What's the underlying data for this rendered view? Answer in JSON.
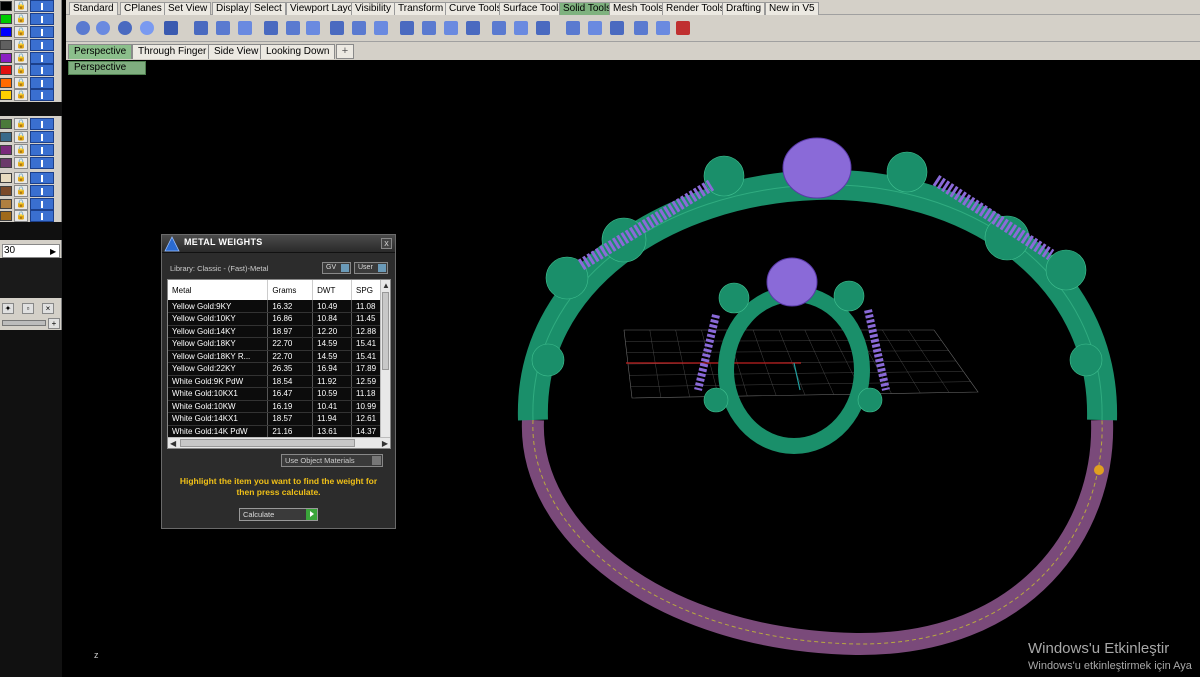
{
  "toolbar": {
    "tabs": [
      "Standard",
      "CPlanes",
      "Set View",
      "Display",
      "Select",
      "Viewport Layout",
      "Visibility",
      "Transform",
      "Curve Tools",
      "Surface Tools",
      "Solid Tools",
      "Mesh Tools",
      "Render Tools",
      "Drafting",
      "New in V5"
    ],
    "active_tab": "Solid Tools"
  },
  "viewport_tabs": {
    "tabs": [
      "Perspective",
      "Through Finger",
      "Side View",
      "Looking Down"
    ],
    "active_tab": "Perspective",
    "add_tab_symbol": "+"
  },
  "viewport": {
    "label": "Perspective",
    "axis_label": "z"
  },
  "left_panel": {
    "value": "30",
    "lock_symbol": "🔒",
    "layer_colors": [
      "#000000",
      "#00cc00",
      "#0000ff",
      "#606060",
      "#8a1fc2",
      "#e01010",
      "#ff6a00",
      "#ffd000",
      "#4a7a3a",
      "#3a6a8a",
      "#7a2a7a",
      "#6a3a6a",
      "#e8dcc0",
      "#7a4a2a",
      "#b08040",
      "#a06a1a"
    ]
  },
  "dialog": {
    "title": "METAL WEIGHTS",
    "close_symbol": "x",
    "library_label": "Library: Classic - (Fast)-Metal",
    "gv_select": "GV",
    "user_select": "User",
    "columns": [
      "Metal",
      "Grams",
      "DWT",
      "SPG"
    ],
    "rows": [
      [
        "Yellow Gold:9KY",
        "16.32",
        "10.49",
        "11.08"
      ],
      [
        "Yellow Gold:10KY",
        "16.86",
        "10.84",
        "11.45"
      ],
      [
        "Yellow Gold:14KY",
        "18.97",
        "12.20",
        "12.88"
      ],
      [
        "Yellow Gold:18KY",
        "22.70",
        "14.59",
        "15.41"
      ],
      [
        "Yellow Gold:18KY R...",
        "22.70",
        "14.59",
        "15.41"
      ],
      [
        "Yellow Gold:22KY",
        "26.35",
        "16.94",
        "17.89"
      ],
      [
        "White Gold:9K PdW",
        "18.54",
        "11.92",
        "12.59"
      ],
      [
        "White Gold:10KX1",
        "16.47",
        "10.59",
        "11.18"
      ],
      [
        "White Gold:10KW",
        "16.19",
        "10.41",
        "10.99"
      ],
      [
        "White Gold:14KX1",
        "18.57",
        "11.94",
        "12.61"
      ],
      [
        "White Gold:14K PdW",
        "21.16",
        "13.61",
        "14.37"
      ]
    ],
    "use_materials": "Use Object Materials",
    "instructions": "Highlight the item you want to find the weight for then press calculate.",
    "calculate_label": "Calculate"
  },
  "watermark": {
    "title": "Windows'u Etkinleştir",
    "subtitle": "Windows'u etkinleştirmek için Aya"
  },
  "colors": {
    "ring_green": "#1a8f6a",
    "ring_purple": "#7a4a7a",
    "gem_purple": "#8a6ad8",
    "accent_tab": "#7fb27f"
  }
}
